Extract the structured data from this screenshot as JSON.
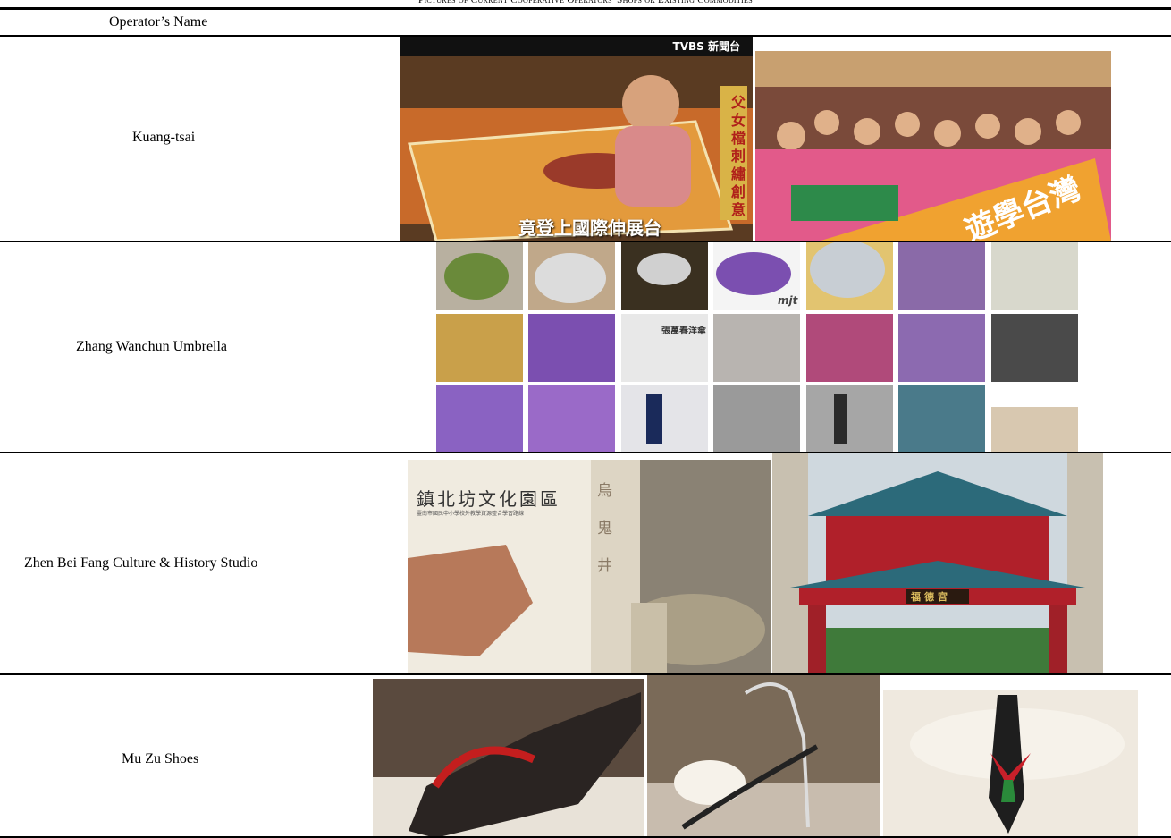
{
  "caption": "Pictures of Current Cooperative Operators' Shops or Existing Commodities",
  "table": {
    "header": "Operator’s Name",
    "rows": [
      {
        "name": "Kuang-tsai"
      },
      {
        "name": "Zhang Wanchun Umbrella"
      },
      {
        "name": "Zhen Bei Fang Culture & History Studio"
      },
      {
        "name": "Mu Zu Shoes"
      }
    ]
  },
  "photo_text": {
    "tvbs": "TVBS 新聞台",
    "tv_side": "父女檔刺繡創意",
    "tv_subtitle": "竟登上國際伸展台",
    "banner": "遊學台灣",
    "umbrella_brand": "mjt",
    "card_name": "張萬春洋傘",
    "book_title": "鎮北坊文化園區",
    "book_subtitle": "臺南市國民中小學校外教學資源整合學習路線",
    "stone_text": "烏鬼井",
    "temple_plaque": "福德宮"
  },
  "colors": {
    "rule": "#000000",
    "umbrella_purple": "#7b4fb0",
    "embroidery_orange": "#d9822b",
    "temple_red": "#b0202a"
  }
}
